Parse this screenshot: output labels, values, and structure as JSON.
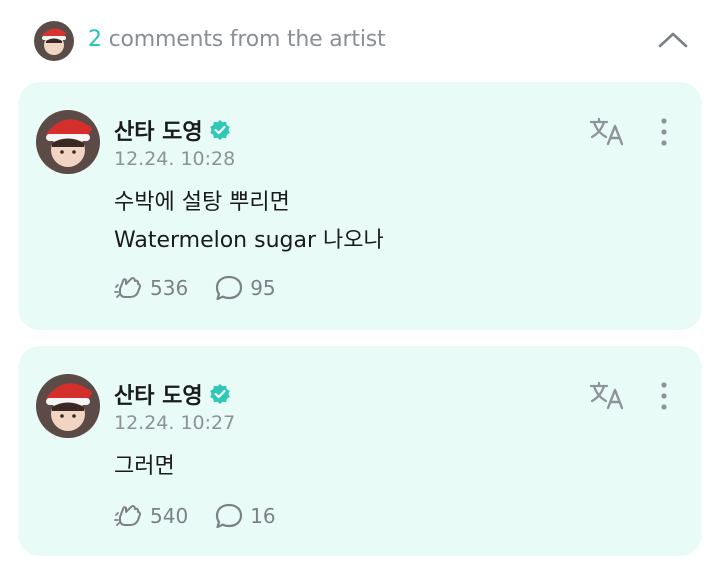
{
  "header": {
    "count": "2",
    "title_text": "comments from the artist"
  },
  "comments": [
    {
      "author": "산타 도영",
      "time": "12.24. 10:28",
      "lines": [
        "수박에 설탕 뿌리면",
        "Watermelon sugar 나오나"
      ],
      "likes": "536",
      "replies": "95"
    },
    {
      "author": "산타 도영",
      "time": "12.24. 10:27",
      "lines": [
        "그러면"
      ],
      "likes": "540",
      "replies": "16"
    }
  ],
  "colors": {
    "accent": "#20c7b4",
    "card_bg": "#e9fbf7",
    "muted": "#8a8f96",
    "verified": "#2fc7b6"
  },
  "icons": {
    "collapse": "chevron-up-icon",
    "verified": "verified-badge-icon",
    "translate": "translate-icon",
    "more": "more-vertical-icon",
    "like": "cheer-hand-icon",
    "reply": "speech-bubble-icon"
  }
}
